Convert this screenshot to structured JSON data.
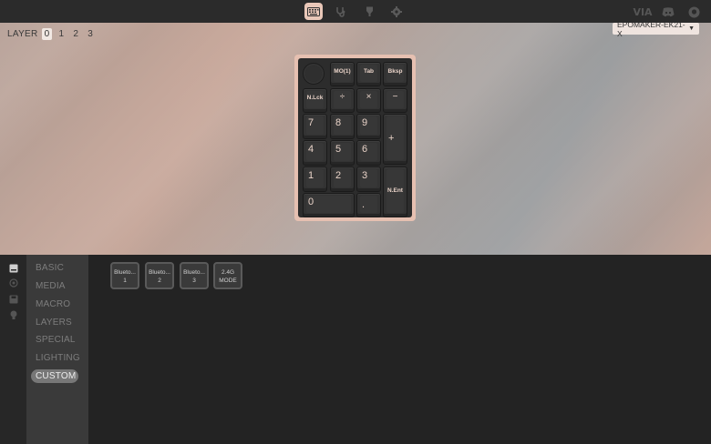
{
  "topbar": {
    "nav": [
      {
        "name": "keyboard-icon",
        "active": true
      },
      {
        "name": "stethoscope-icon",
        "active": false
      },
      {
        "name": "beaker-icon",
        "active": false
      },
      {
        "name": "gear-icon",
        "active": false
      }
    ],
    "right": {
      "via_label": "VIA"
    }
  },
  "canvas": {
    "layer_label": "LAYER",
    "layers": [
      "0",
      "1",
      "2",
      "3"
    ],
    "active_layer": "0",
    "device": "EPOMAKER-EK21-X"
  },
  "keyboard": {
    "keys": [
      {
        "label": "MO(1)",
        "style": "small"
      },
      {
        "label": "Tab",
        "style": "small"
      },
      {
        "label": "Bksp",
        "style": "small"
      },
      {
        "label": "N.Lck",
        "style": "small"
      },
      {
        "label": "÷",
        "style": "mid"
      },
      {
        "label": "×",
        "style": "mid"
      },
      {
        "label": "−",
        "style": "mid"
      },
      {
        "label": "7",
        "style": "big"
      },
      {
        "label": "8",
        "style": "big"
      },
      {
        "label": "9",
        "style": "big"
      },
      {
        "label": "+",
        "style": "big"
      },
      {
        "label": "4",
        "style": "big"
      },
      {
        "label": "5",
        "style": "big"
      },
      {
        "label": "6",
        "style": "big"
      },
      {
        "label": "1",
        "style": "big"
      },
      {
        "label": "2",
        "style": "big"
      },
      {
        "label": "3",
        "style": "big"
      },
      {
        "label": "N.Ent",
        "style": "small"
      },
      {
        "label": "0",
        "style": "big"
      },
      {
        "label": ".",
        "style": "big"
      }
    ]
  },
  "sidebar": {
    "icons": [
      "keyboard-key-icon",
      "circle-icon",
      "save-icon",
      "lightbulb-icon"
    ]
  },
  "menu": {
    "items": [
      "BASIC",
      "MEDIA",
      "MACRO",
      "LAYERS",
      "SPECIAL",
      "LIGHTING",
      "CUSTOM"
    ],
    "active": "CUSTOM"
  },
  "custom_keys": [
    {
      "line1": "Blueto...",
      "line2": "1"
    },
    {
      "line1": "Blueto...",
      "line2": "2"
    },
    {
      "line1": "Blueto...",
      "line2": "3"
    },
    {
      "line1": "2.4G",
      "line2": "MODE"
    }
  ]
}
